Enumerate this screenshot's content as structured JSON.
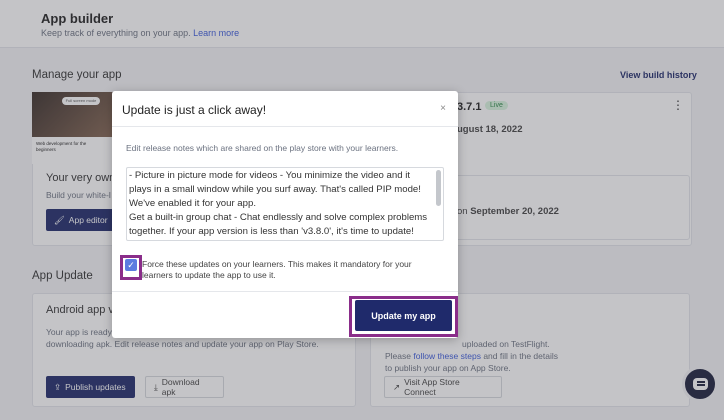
{
  "header": {
    "title": "App builder",
    "subtitle": "Keep track of everything on your app.",
    "learn_more": "Learn more"
  },
  "manage": {
    "title": "Manage your app",
    "view_history": "View build history",
    "card_title": "Your very own",
    "card_sub": "Build your white-l",
    "app_editor_btn": "App editor",
    "thumb_badge": "Full screen mode",
    "thumb_caption": "Web development for the beginners",
    "version": "3.7.1",
    "live_badge": "Live",
    "published_date": "ugust 18, 2022",
    "next_date_prefix": "on",
    "next_date": "September 20, 2022"
  },
  "update_section": {
    "title": "App Update",
    "android_title": "Android app v",
    "android_desc_1": "Your app is ready",
    "android_desc_2": "downloading apk. Edit release notes and update your app on Play Store.",
    "publish_btn": "Publish updates",
    "download_btn": "Download apk",
    "ios_desc_1": "uploaded on TestFlight.",
    "ios_desc_2_prefix": "Please",
    "ios_desc_2_link": "follow these steps",
    "ios_desc_2_suffix": "and fill in the details",
    "ios_desc_3": "to publish your app on App Store.",
    "visit_btn": "Visit App Store Connect"
  },
  "modal": {
    "title": "Update is just a click away!",
    "close": "×",
    "description": "Edit release notes which are shared on the play store with your learners.",
    "release_notes": "- Picture in picture mode for videos - You minimize the video and it plays in a small window while you surf away. That's called PIP mode! We've enabled it for your app.\nGet a built-in group chat - Chat endlessly and solve complex problems together. If your app version is less than 'v3.8.0', it's time to update!",
    "force_label": "Force these updates on your learners. This makes it mandatory for your learners to update the app to use it.",
    "force_checked": true,
    "update_btn": "Update my app"
  },
  "colors": {
    "primary": "#1f2a6b",
    "highlight": "#8a2d8a",
    "checkbox": "#5c7ce0",
    "live": "#2e8a49"
  }
}
